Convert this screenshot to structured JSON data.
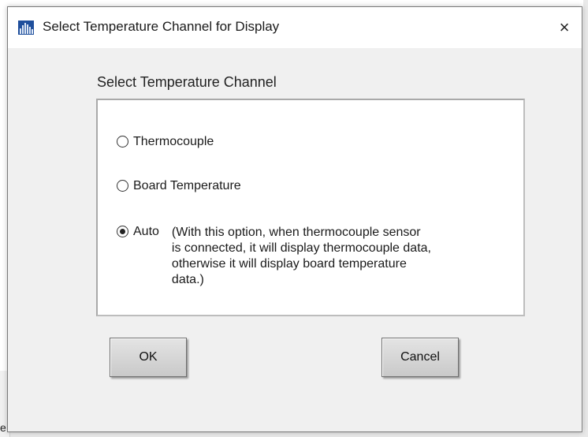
{
  "dialog": {
    "title": "Select Temperature Channel for Display",
    "close_symbol": "×",
    "icon": "bar-chart-app-icon"
  },
  "group": {
    "label": "Select Temperature Channel",
    "options": [
      {
        "label": "Thermocouple",
        "checked": false
      },
      {
        "label": "Board Temperature",
        "checked": false
      },
      {
        "label": "Auto",
        "checked": true,
        "description": "(With this option, when thermocouple sensor is connected, it will display thermocouple data, otherwise it will display board temperature data.)"
      }
    ]
  },
  "buttons": {
    "ok_label": "OK",
    "cancel_label": "Cancel"
  },
  "background": {
    "left_char": "e"
  },
  "colors": {
    "dialog_bg": "#f0f0f0",
    "panel_bg": "#ffffff",
    "icon_blue": "#1f4f9c"
  }
}
